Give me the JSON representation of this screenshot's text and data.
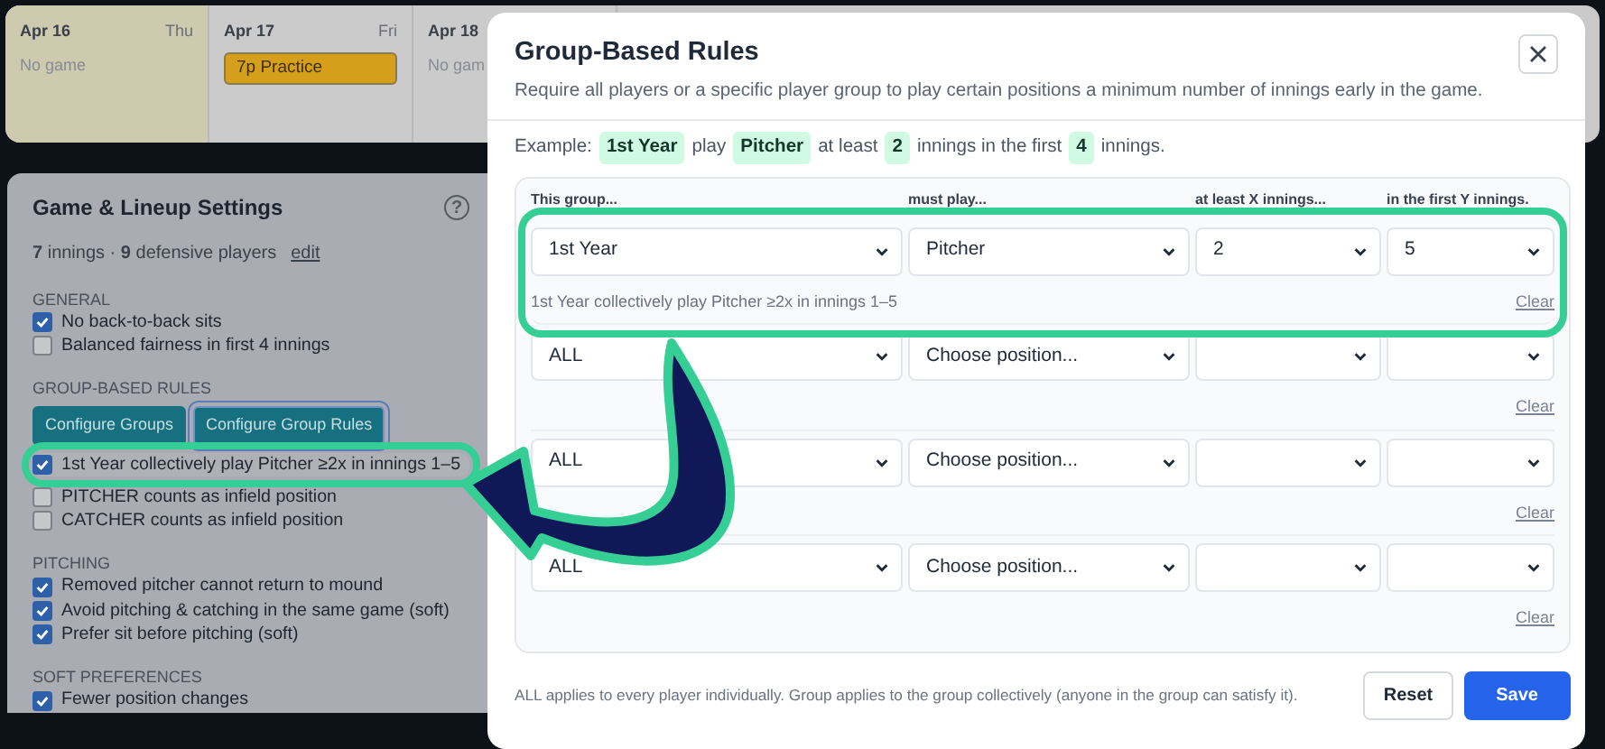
{
  "calendar": [
    {
      "date": "Apr 16",
      "weekday": "Thu",
      "selected": true,
      "items": [
        {
          "kind": "note",
          "text": "No game"
        }
      ]
    },
    {
      "date": "Apr 17",
      "weekday": "Fri",
      "selected": false,
      "items": [
        {
          "kind": "event",
          "text": "7p Practice"
        }
      ]
    },
    {
      "date": "Apr 18",
      "selected": false,
      "items": [
        {
          "kind": "note",
          "text": "No gam"
        }
      ]
    }
  ],
  "settings": {
    "title": "Game & Lineup Settings",
    "help_icon": "?",
    "summary": "**7** innings · **9** defensive players",
    "edit_link": "edit",
    "sections": [
      {
        "heading": "GENERAL",
        "items": [
          {
            "label": "No back-to-back sits",
            "checked": true
          },
          {
            "label": "Balanced fairness in first 4 innings",
            "checked": false
          }
        ]
      },
      {
        "heading": "GROUP-BASED RULES",
        "buttons": [
          {
            "label": "Configure Groups",
            "selected": false
          },
          {
            "label": "Configure Group Rules",
            "selected": true
          }
        ],
        "items": [
          {
            "label": "1st Year collectively play Pitcher ≥2x in innings 1–5",
            "checked": true,
            "highlighted": true
          },
          {
            "label": "PITCHER counts as infield position",
            "checked": false
          },
          {
            "label": "CATCHER counts as infield position",
            "checked": false
          }
        ]
      },
      {
        "heading": "PITCHING",
        "items": [
          {
            "label": "Removed pitcher cannot return to mound",
            "checked": true
          },
          {
            "label": "Avoid pitching & catching in the same game (soft)",
            "checked": true
          },
          {
            "label": "Prefer sit before pitching (soft)",
            "checked": true
          }
        ]
      },
      {
        "heading": "SOFT PREFERENCES",
        "items": [
          {
            "label": "Fewer position changes",
            "checked": true
          }
        ]
      }
    ]
  },
  "modal": {
    "title": "Group-Based Rules",
    "subtitle": "Require all players or a specific player group to play certain positions a minimum number of innings early in the game.",
    "example": [
      {
        "kind": "text",
        "text": "Example:"
      },
      {
        "kind": "pill",
        "text": "1st Year"
      },
      {
        "kind": "text",
        "text": "play"
      },
      {
        "kind": "pill",
        "text": "Pitcher"
      },
      {
        "kind": "text",
        "text": "at least"
      },
      {
        "kind": "pill",
        "text": "2"
      },
      {
        "kind": "text",
        "text": "innings in the first"
      },
      {
        "kind": "pill",
        "text": "4"
      },
      {
        "kind": "text",
        "text": "innings."
      }
    ],
    "columns": [
      "This group...",
      "must play...",
      "at least X innings...",
      "in the first Y innings."
    ],
    "rules": [
      {
        "group": "1st Year",
        "position": "Pitcher",
        "min_innings": "2",
        "first_innings": "5",
        "summary": "1st Year collectively play Pitcher ≥2x in innings 1–5",
        "clear": "Clear",
        "highlighted": true
      },
      {
        "group": "ALL",
        "position": "Choose position...",
        "clear": "Clear"
      },
      {
        "group": "ALL",
        "position": "Choose position...",
        "clear": "Clear"
      },
      {
        "group": "ALL",
        "position": "Choose position...",
        "clear": "Clear"
      }
    ],
    "footer_note": "ALL applies to every player individually. Group applies to the group collectively (anyone in the group can satisfy it).",
    "buttons": [
      {
        "label": "Reset",
        "kind": "secondary"
      },
      {
        "label": "Save",
        "kind": "primary"
      }
    ]
  },
  "annotation_arrow": true
}
